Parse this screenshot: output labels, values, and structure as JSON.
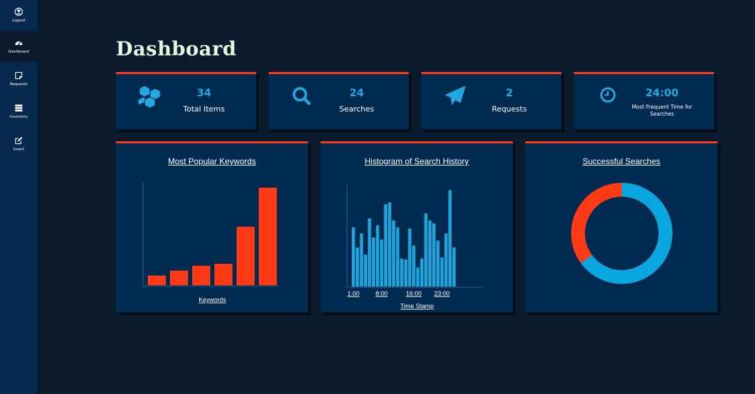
{
  "sidebar": {
    "items": [
      {
        "label": "Logout",
        "icon": "user-circle-icon"
      },
      {
        "label": "Dashboard",
        "icon": "speedometer-icon"
      },
      {
        "label": "Requests",
        "icon": "sticky-note-icon"
      },
      {
        "label": "Inventory",
        "icon": "server-icon"
      },
      {
        "label": "Insert",
        "icon": "edit-icon"
      }
    ]
  },
  "page": {
    "title": "Dashboard"
  },
  "stats": [
    {
      "value": "34",
      "label": "Total Items",
      "icon": "cubes-icon"
    },
    {
      "value": "24",
      "label": "Searches",
      "icon": "search-icon"
    },
    {
      "value": "2",
      "label": "Requests",
      "icon": "paper-plane-icon"
    },
    {
      "value": "24:00",
      "label": "Most Frequent Time for Searches",
      "icon": "clock-icon"
    }
  ],
  "colors": {
    "accent": "#ff3a14",
    "blue": "#22a9e0",
    "card": "#012a51",
    "background": "#0b1b2e"
  },
  "chart_data": [
    {
      "type": "bar",
      "title": "Most Popular Keywords",
      "xlabel": "Keywords",
      "ylabel": "",
      "categories": [
        "",
        "",
        "",
        "",
        "",
        ""
      ],
      "values": [
        1,
        1.5,
        2,
        2.2,
        6,
        10
      ],
      "ylim": [
        0,
        10
      ],
      "color": "#ff3a14"
    },
    {
      "type": "bar",
      "title": "Histogram of Search History",
      "xlabel": "Time Stamp",
      "ylabel": "",
      "tick_labels": [
        "1:00",
        "8:00",
        "16:00",
        "23:00"
      ],
      "tick_positions": [
        0,
        7,
        15,
        22
      ],
      "values": [
        5.9,
        3.9,
        5.3,
        3.2,
        6.8,
        4.9,
        6.1,
        4.7,
        8.2,
        8.4,
        6.6,
        5.9,
        2.8,
        2.7,
        5.8,
        4.1,
        1.9,
        2.8,
        7.3,
        6.6,
        6.3,
        4.6,
        2.9,
        5.3,
        9.6,
        3.9
      ],
      "ylim": [
        0,
        10
      ],
      "color": "#1ca5dc"
    },
    {
      "type": "pie",
      "title": "Successful Searches",
      "slices": [
        {
          "label": "",
          "value": 65,
          "color": "#0aa6e0"
        },
        {
          "label": "",
          "value": 35,
          "color": "#ff3a14"
        }
      ]
    }
  ]
}
